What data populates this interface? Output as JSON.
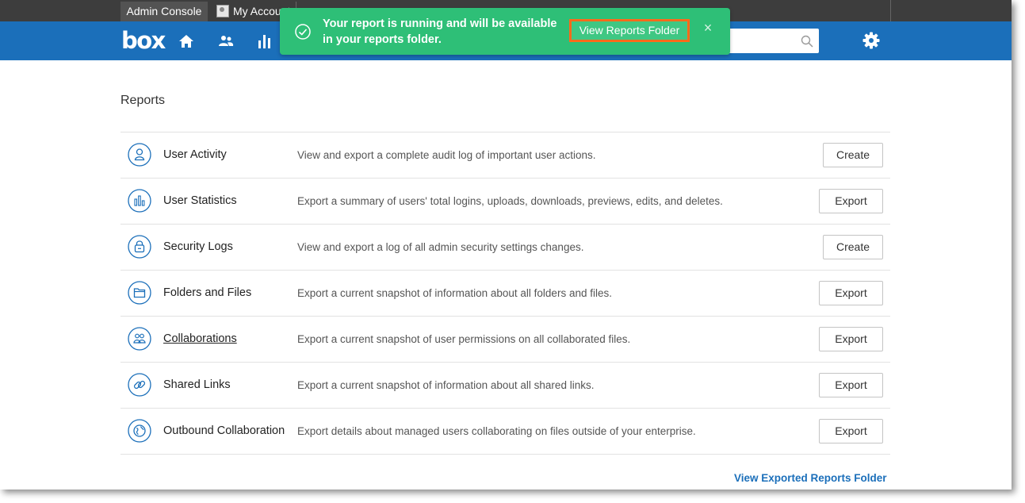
{
  "tabs": {
    "admin_console": "Admin Console",
    "my_account": "My Account"
  },
  "header": {
    "logo": "box",
    "nav_icons": [
      "home-icon",
      "users-icon",
      "reports-icon"
    ],
    "search_placeholder": "Search",
    "settings_icon": "gear-icon"
  },
  "toast": {
    "message": "Your report is running and will be available in your reports folder.",
    "view_button": "View Reports Folder",
    "close": "×",
    "icon": "check-circle-icon"
  },
  "page": {
    "title": "Reports"
  },
  "reports": [
    {
      "name": "User Activity",
      "desc": "View and export a complete audit log of important user actions.",
      "action": "Create",
      "icon": "user-icon"
    },
    {
      "name": "User Statistics",
      "desc": "Export a summary of users' total logins, uploads, downloads, previews, edits, and deletes.",
      "action": "Export",
      "icon": "bar-chart-icon"
    },
    {
      "name": "Security Logs",
      "desc": "View and export a log of all admin security settings changes.",
      "action": "Create",
      "icon": "lock-icon"
    },
    {
      "name": "Folders and Files",
      "desc": "Export a current snapshot of information about all folders and files.",
      "action": "Export",
      "icon": "folder-icon"
    },
    {
      "name": "Collaborations",
      "desc": "Export a current snapshot of user permissions on all collaborated files.",
      "action": "Export",
      "icon": "collaborators-icon"
    },
    {
      "name": "Shared Links",
      "desc": "Export a current snapshot of information about all shared links.",
      "action": "Export",
      "icon": "link-icon"
    },
    {
      "name": "Outbound Collaboration",
      "desc": "Export details about managed users collaborating on files outside of your enterprise.",
      "action": "Export",
      "icon": "globe-icon"
    }
  ],
  "footer": {
    "link": "View Exported Reports Folder"
  },
  "colors": {
    "header_blue": "#1b6fba",
    "toast_green": "#2ebf77",
    "highlight_orange": "#ff6a1a"
  }
}
